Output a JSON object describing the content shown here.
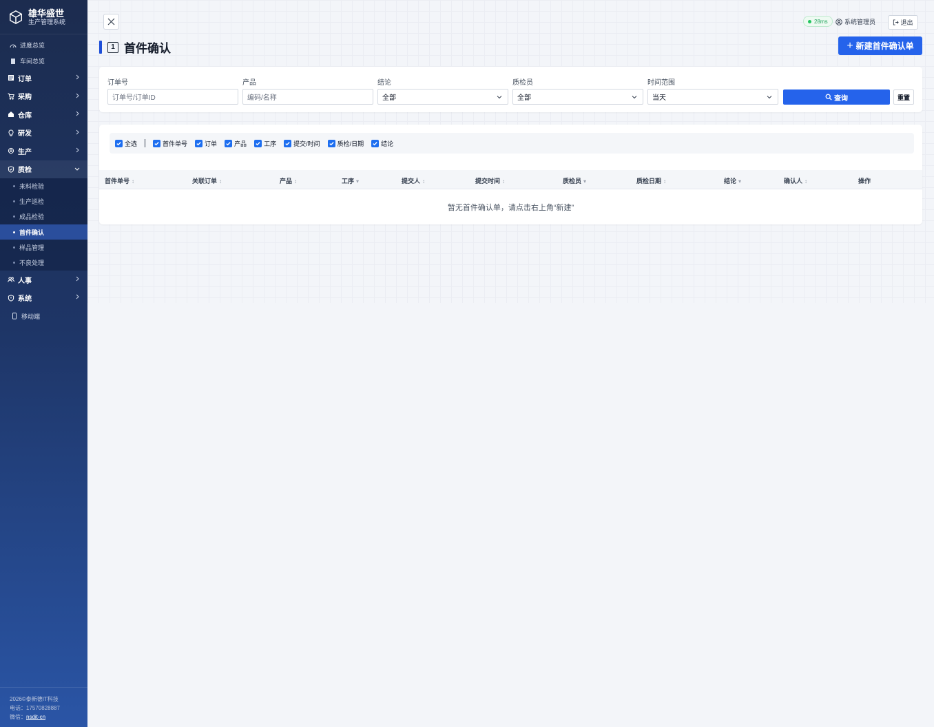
{
  "brand": {
    "title": "雄华盛世",
    "subtitle": "生产管理系统"
  },
  "nav": {
    "progress": "进度总览",
    "workshop": "车间总览",
    "orders": "订单",
    "purchase": "采购",
    "warehouse": "仓库",
    "rd": "研发",
    "production": "生产",
    "qc": "质检",
    "qc_items": [
      "来料检验",
      "生产巡检",
      "成品检验",
      "首件确认",
      "样品管理",
      "不良处理"
    ],
    "hr": "人事",
    "system": "系统",
    "mobile": "移动端"
  },
  "footer": {
    "copyright": "2026©泰新德IT科技",
    "phone": "电话：17570828887",
    "wechat_label": "微信：",
    "wechat": "nsdit-cn"
  },
  "topbar": {
    "latency": "28ms",
    "user": "系统管理员",
    "logout": "退出"
  },
  "page": {
    "number": "1",
    "title": "首件确认",
    "new_button": "新建首件确认单"
  },
  "filters": {
    "order_label": "订单号",
    "order_placeholder": "订单号/订单ID",
    "product_label": "产品",
    "product_placeholder": "编码/名称",
    "result_label": "结论",
    "result_value": "全部",
    "inspector_label": "质检员",
    "inspector_value": "全部",
    "time_label": "时间范围",
    "time_value": "当天",
    "query": "查询",
    "reset": "重置"
  },
  "columns_toggle": [
    "全选",
    "首件单号",
    "订单",
    "产品",
    "工序",
    "提交/时间",
    "质检/日期",
    "结论"
  ],
  "table": {
    "headers": [
      "首件单号",
      "关联订单",
      "产品",
      "工序",
      "提交人",
      "提交时间",
      "质检员",
      "质检日期",
      "结论",
      "确认人",
      "操作"
    ],
    "empty": "暂无首件确认单，请点击右上角“新建”"
  },
  "colors": {
    "accent": "#2563eb",
    "sidebar": "#1e3566",
    "active": "#2a4e9c"
  }
}
